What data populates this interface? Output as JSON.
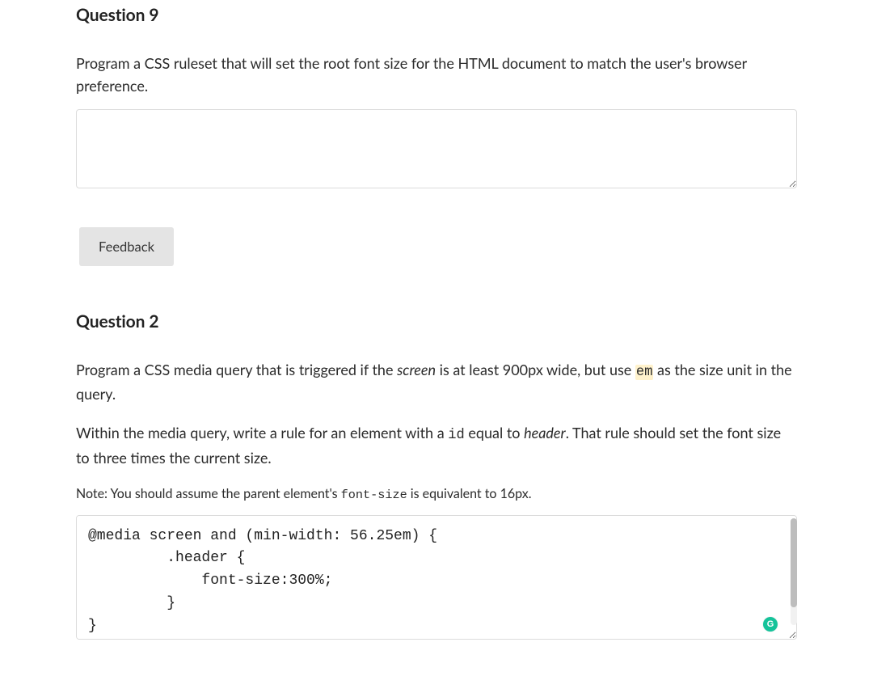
{
  "q9": {
    "title": "Question 9",
    "prompt": "Program a CSS ruleset that will set the root font size for the HTML document to match the user's browser preference.",
    "answer_value": "",
    "feedback_label": "Feedback"
  },
  "q2": {
    "title": "Question 2",
    "prompt_pre": "Program a CSS media query that is triggered if the ",
    "prompt_screen": "screen",
    "prompt_mid1": " is at least 900px wide, but use ",
    "prompt_em": "em",
    "prompt_post1": " as the size unit in the query.",
    "prompt2_pre": "Within the media query, write a rule for an element with a ",
    "prompt2_id": "id",
    "prompt2_mid": " equal to ",
    "prompt2_header": "header",
    "prompt2_post": ". That rule should set the font size to three times the current size.",
    "note_pre": "Note: You should assume the parent element's ",
    "note_code": "font-size",
    "note_post": " is equivalent to 16px.",
    "code_value": "@media screen and (min-width: 56.25em) {\n         .header {\n             font-size:300%;\n         }\n}"
  },
  "icons": {
    "grammarly_letter": "G"
  }
}
